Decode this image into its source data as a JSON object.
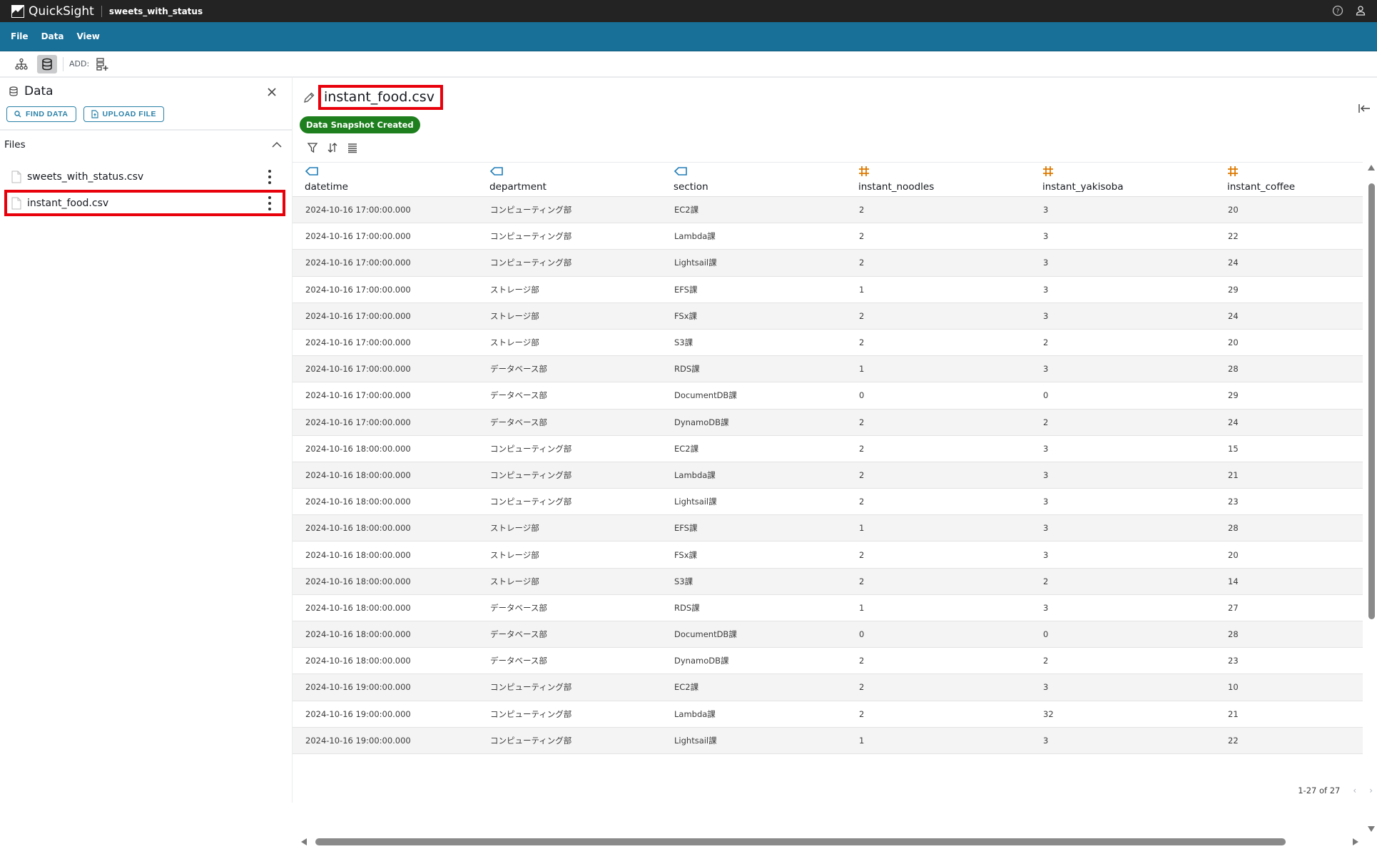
{
  "app": {
    "name": "QuickSight",
    "document_title": "sweets_with_status"
  },
  "menu": [
    "File",
    "Data",
    "View"
  ],
  "toolbar": {
    "add_label": "ADD:"
  },
  "sidebar": {
    "title": "Data",
    "find_data": "FIND DATA",
    "upload_file": "UPLOAD FILE",
    "files_section": "Files",
    "files": [
      {
        "name": "sweets_with_status.csv",
        "selected": false
      },
      {
        "name": "instant_food.csv",
        "selected": true
      }
    ]
  },
  "dataset": {
    "title": "instant_food.csv",
    "status_badge": "Data Snapshot Created",
    "status_color": "#1d7f1d"
  },
  "table": {
    "columns": [
      {
        "name": "datetime",
        "type": "string"
      },
      {
        "name": "department",
        "type": "string"
      },
      {
        "name": "section",
        "type": "string"
      },
      {
        "name": "instant_noodles",
        "type": "number"
      },
      {
        "name": "instant_yakisoba",
        "type": "number"
      },
      {
        "name": "instant_coffee",
        "type": "number"
      }
    ],
    "rows": [
      [
        "2024-10-16 17:00:00.000",
        "コンピューティング部",
        "EC2課",
        "2",
        "3",
        "20"
      ],
      [
        "2024-10-16 17:00:00.000",
        "コンピューティング部",
        "Lambda課",
        "2",
        "3",
        "22"
      ],
      [
        "2024-10-16 17:00:00.000",
        "コンピューティング部",
        "Lightsail課",
        "2",
        "3",
        "24"
      ],
      [
        "2024-10-16 17:00:00.000",
        "ストレージ部",
        "EFS課",
        "1",
        "3",
        "29"
      ],
      [
        "2024-10-16 17:00:00.000",
        "ストレージ部",
        "FSx課",
        "2",
        "3",
        "24"
      ],
      [
        "2024-10-16 17:00:00.000",
        "ストレージ部",
        "S3課",
        "2",
        "2",
        "20"
      ],
      [
        "2024-10-16 17:00:00.000",
        "データベース部",
        "RDS課",
        "1",
        "3",
        "28"
      ],
      [
        "2024-10-16 17:00:00.000",
        "データベース部",
        "DocumentDB課",
        "0",
        "0",
        "29"
      ],
      [
        "2024-10-16 17:00:00.000",
        "データベース部",
        "DynamoDB課",
        "2",
        "2",
        "24"
      ],
      [
        "2024-10-16 18:00:00.000",
        "コンピューティング部",
        "EC2課",
        "2",
        "3",
        "15"
      ],
      [
        "2024-10-16 18:00:00.000",
        "コンピューティング部",
        "Lambda課",
        "2",
        "3",
        "21"
      ],
      [
        "2024-10-16 18:00:00.000",
        "コンピューティング部",
        "Lightsail課",
        "2",
        "3",
        "23"
      ],
      [
        "2024-10-16 18:00:00.000",
        "ストレージ部",
        "EFS課",
        "1",
        "3",
        "28"
      ],
      [
        "2024-10-16 18:00:00.000",
        "ストレージ部",
        "FSx課",
        "2",
        "3",
        "20"
      ],
      [
        "2024-10-16 18:00:00.000",
        "ストレージ部",
        "S3課",
        "2",
        "2",
        "14"
      ],
      [
        "2024-10-16 18:00:00.000",
        "データベース部",
        "RDS課",
        "1",
        "3",
        "27"
      ],
      [
        "2024-10-16 18:00:00.000",
        "データベース部",
        "DocumentDB課",
        "0",
        "0",
        "28"
      ],
      [
        "2024-10-16 18:00:00.000",
        "データベース部",
        "DynamoDB課",
        "2",
        "2",
        "23"
      ],
      [
        "2024-10-16 19:00:00.000",
        "コンピューティング部",
        "EC2課",
        "2",
        "3",
        "10"
      ],
      [
        "2024-10-16 19:00:00.000",
        "コンピューティング部",
        "Lambda課",
        "2",
        "32",
        "21"
      ],
      [
        "2024-10-16 19:00:00.000",
        "コンピューティング部",
        "Lightsail課",
        "1",
        "3",
        "22"
      ]
    ],
    "pagination": "1-27 of 27"
  },
  "colors": {
    "topbar": "#232323",
    "navbar": "#186f98",
    "accent": "#2a81a8",
    "highlight": "#e8000b",
    "string_type": "#1f7db8",
    "number_type": "#dd7a00"
  }
}
